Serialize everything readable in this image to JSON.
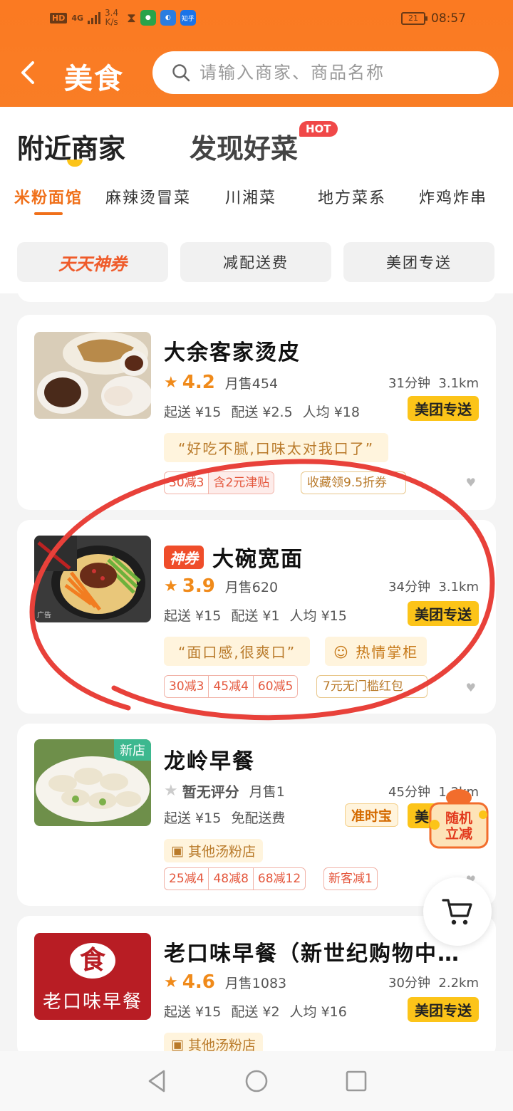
{
  "statusbar": {
    "hd": "HD",
    "net": "4G",
    "speed_value": "3.4",
    "speed_unit": "K/s",
    "zhihu": "知乎",
    "battery": "21",
    "time": "08:57"
  },
  "header": {
    "title": "美食",
    "search_placeholder": "请输入商家、商品名称"
  },
  "main_tabs": [
    {
      "label": "附近商家"
    },
    {
      "label": "发现好菜",
      "badge": "HOT"
    }
  ],
  "categories": [
    "米粉面馆",
    "麻辣烫冒菜",
    "川湘菜",
    "地方菜系",
    "炸鸡炸串"
  ],
  "filters": [
    "天天神券",
    "减配送费",
    "美团专送"
  ],
  "shops": [
    {
      "name": "大余客家烫皮",
      "rating": "4.2",
      "monthly": "月售454",
      "time": "31分钟",
      "distance": "3.1km",
      "fees": [
        "起送 ¥15",
        "配送 ¥2.5",
        "人均 ¥18"
      ],
      "delivery_badge": "美团专送",
      "quote": "“好吃不腻,口味太对我口了”",
      "promos": [
        "30减3",
        "含2元津贴"
      ],
      "gold_tag": "收藏领9.5折券"
    },
    {
      "name": "大碗宽面",
      "coupon_badge": "神券",
      "ad": "广告",
      "rating": "3.9",
      "monthly": "月售620",
      "time": "34分钟",
      "distance": "3.1km",
      "fees": [
        "起送 ¥15",
        "配送 ¥1",
        "人均 ¥15"
      ],
      "delivery_badge": "美团专送",
      "quote": "“面口感,很爽口”",
      "quote2": "热情掌柜",
      "promos": [
        "30减3",
        "45减4",
        "60减5"
      ],
      "gold_tag": "7元无门槛红包"
    },
    {
      "name": "龙岭早餐",
      "new_badge": "新店",
      "rating_text": "暂无评分",
      "monthly": "月售1",
      "time": "45分钟",
      "distance": "1.2km",
      "fees": [
        "起送 ¥15",
        "免配送费"
      ],
      "ontime_badge": "准时宝",
      "delivery_badge": "美团专送",
      "store_tag": "其他汤粉店",
      "promos": [
        "25减4",
        "48减8",
        "68减12"
      ],
      "promo_extra": "新客减1"
    },
    {
      "name": "老口味早餐（新世纪购物中…",
      "logo_char": "食",
      "logo_text": "老口味早餐",
      "rating": "4.6",
      "monthly": "月售1083",
      "time": "30分钟",
      "distance": "2.2km",
      "fees": [
        "起送 ¥15",
        "配送 ¥2",
        "人均 ¥16"
      ],
      "delivery_badge": "美团专送",
      "store_tag": "其他汤粉店"
    }
  ],
  "float_promo": {
    "line1": "随机",
    "line2": "立减"
  },
  "colors": {
    "brand_orange": "#fb7a22",
    "yellow": "#fcc419",
    "annotation_red": "#e8413a"
  }
}
